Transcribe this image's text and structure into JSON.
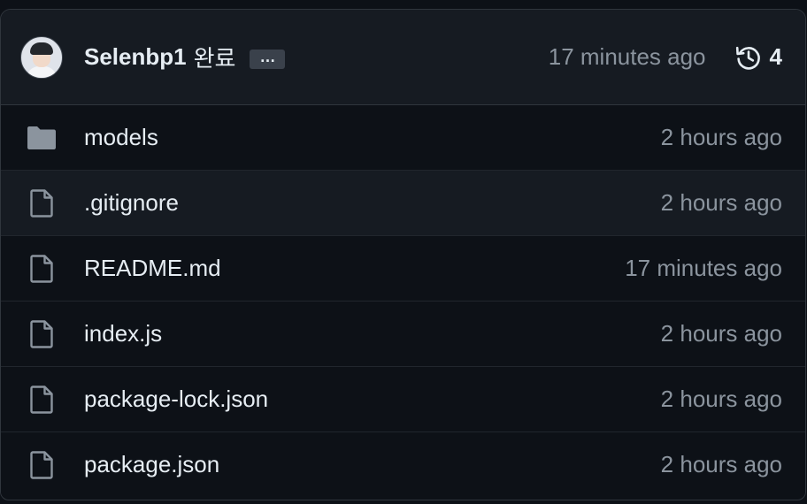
{
  "commit": {
    "author": "Selenbp1",
    "message": "완료",
    "ellipsis": "…",
    "time": "17 minutes ago",
    "history_count": "4"
  },
  "files": [
    {
      "name": "models",
      "type": "folder",
      "time": "2 hours ago",
      "icon": "folder-icon"
    },
    {
      "name": ".gitignore",
      "type": "file",
      "time": "2 hours ago",
      "icon": "file-icon"
    },
    {
      "name": "README.md",
      "type": "file",
      "time": "17 minutes ago",
      "icon": "file-icon"
    },
    {
      "name": "index.js",
      "type": "file",
      "time": "2 hours ago",
      "icon": "file-icon"
    },
    {
      "name": "package-lock.json",
      "type": "file",
      "time": "2 hours ago",
      "icon": "file-icon"
    },
    {
      "name": "package.json",
      "type": "file",
      "time": "2 hours ago",
      "icon": "file-icon"
    }
  ],
  "colors": {
    "background": "#0d1117",
    "header_background": "#161b22",
    "border": "#30363d",
    "text_primary": "#e6edf3",
    "text_muted": "#8b949e",
    "icon": "#8b949e"
  }
}
